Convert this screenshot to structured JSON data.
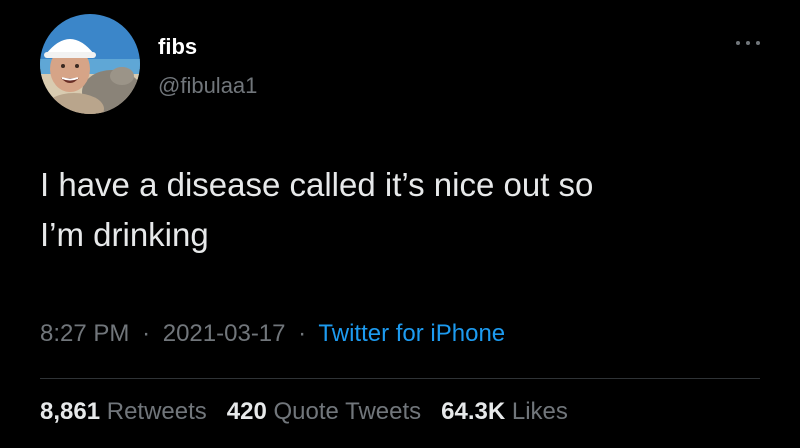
{
  "user": {
    "display_name": "fibs",
    "handle": "@fibulaa1"
  },
  "tweet": {
    "lines": [
      "I have a disease called it’s nice out so",
      "I’m drinking"
    ],
    "time": "8:27 PM",
    "separator": "·",
    "date": "2021-03-17",
    "source": "Twitter for iPhone"
  },
  "stats": {
    "retweets_count": "8,861",
    "retweets_label": "Retweets",
    "quotes_count": "420",
    "quotes_label": "Quote Tweets",
    "likes_count": "64.3K",
    "likes_label": "Likes"
  },
  "icons": {
    "more": "more-horizontal-icon"
  },
  "colors": {
    "background": "#000000",
    "primary_text": "#e7e9ea",
    "secondary_text": "#71767b",
    "accent": "#1d9bf0",
    "divider": "#2f3336"
  }
}
